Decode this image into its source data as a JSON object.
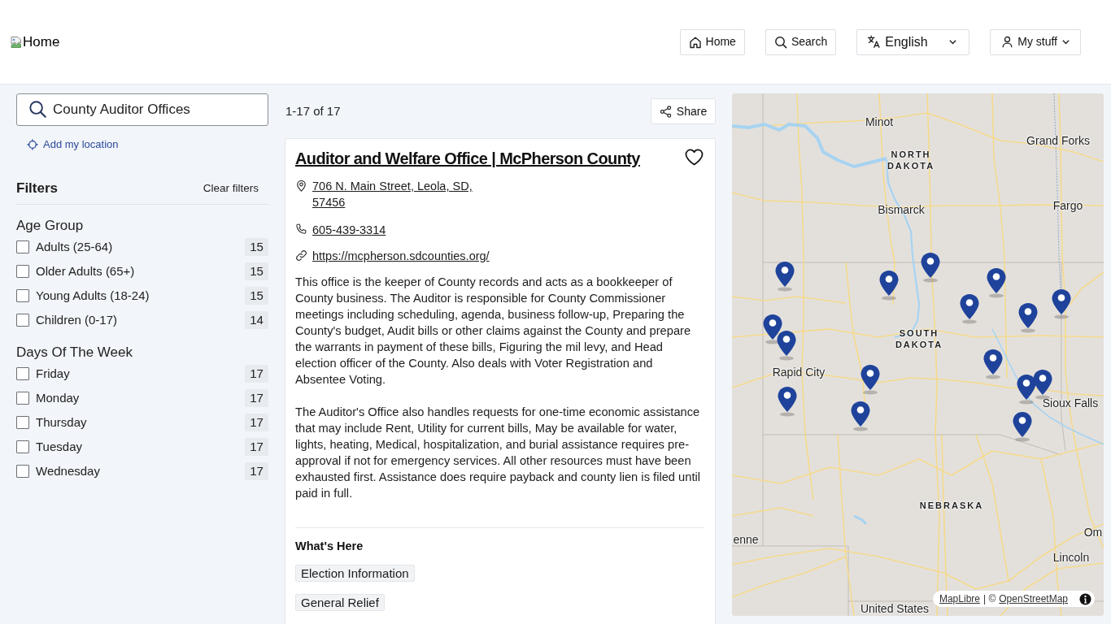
{
  "header": {
    "logo_alt": "Home",
    "nav": [
      {
        "label": "Home",
        "kind": "home",
        "dropdown": false
      },
      {
        "label": "Search",
        "kind": "search",
        "dropdown": false
      },
      {
        "label": "English",
        "kind": "language",
        "dropdown": true
      },
      {
        "label": "My stuff",
        "kind": "account",
        "dropdown": true
      }
    ]
  },
  "search": {
    "value": "County Auditor Offices",
    "location_link": "Add my location"
  },
  "filters": {
    "title": "Filters",
    "clear": "Clear filters",
    "groups": [
      {
        "title": "Age Group",
        "options": [
          {
            "label": "Adults (25-64)",
            "count": "15",
            "checked": false
          },
          {
            "label": "Older Adults (65+)",
            "count": "15",
            "checked": false
          },
          {
            "label": "Young Adults (18-24)",
            "count": "15",
            "checked": false
          },
          {
            "label": "Children (0-17)",
            "count": "14",
            "checked": false
          }
        ]
      },
      {
        "title": "Days Of The Week",
        "options": [
          {
            "label": "Friday",
            "count": "17",
            "checked": false
          },
          {
            "label": "Monday",
            "count": "17",
            "checked": false
          },
          {
            "label": "Thursday",
            "count": "17",
            "checked": false
          },
          {
            "label": "Tuesday",
            "count": "17",
            "checked": false
          },
          {
            "label": "Wednesday",
            "count": "17",
            "checked": false
          }
        ]
      }
    ]
  },
  "results": {
    "summary": "1-17 of 17",
    "share": "Share",
    "card": {
      "title": "Auditor and Welfare Office | McPherson County",
      "favorite": false,
      "address": "706 N. Main Street, Leola, SD, 57456",
      "phone": "605-439-3314",
      "website": "https://mcpherson.sdcounties.org/",
      "description": [
        "This office is the keeper of County records and acts as a bookkeeper of County business. The Auditor is responsible for County Commissioner meetings including scheduling, agenda, business follow-up, Preparing the County's budget, Audit bills or other claims against the County and prepare the warrants in payment of these bills, Figuring the mil levy, and Head election officer of the County. Also deals with Voter Registration and Absentee Voting.",
        "The Auditor's Office also handles requests for one-time economic assistance that may include Rent, Utility for current bills, May be available for water, lights, heating, Medical, hospitalization, and burial assistance requires pre-approval if not for emergency services. All other resources must have been exhausted first. Assistance does require payback and county lien is filed until paid in full."
      ],
      "section_title": "What's Here",
      "tags": [
        "Election Information",
        "General Relief"
      ]
    }
  },
  "map": {
    "labels": [
      {
        "text": "Minot",
        "kind": "city"
      },
      {
        "text": "NORTH DAKOTA",
        "kind": "state"
      },
      {
        "text": "Grand Forks",
        "kind": "city"
      },
      {
        "text": "Bismarck",
        "kind": "city"
      },
      {
        "text": "Fargo",
        "kind": "city"
      },
      {
        "text": "SOUTH DAKOTA",
        "kind": "state"
      },
      {
        "text": "Rapid City",
        "kind": "city"
      },
      {
        "text": "Sioux Falls",
        "kind": "city"
      },
      {
        "text": "NEBRASKA",
        "kind": "state"
      },
      {
        "text": "enne",
        "kind": "city"
      },
      {
        "text": "Om",
        "kind": "city"
      },
      {
        "text": "Lincoln",
        "kind": "city"
      },
      {
        "text": "United States",
        "kind": "country"
      }
    ],
    "attribution": {
      "links": [
        "MapLibre",
        "OpenStreetMap"
      ],
      "separator": "| ©"
    }
  }
}
